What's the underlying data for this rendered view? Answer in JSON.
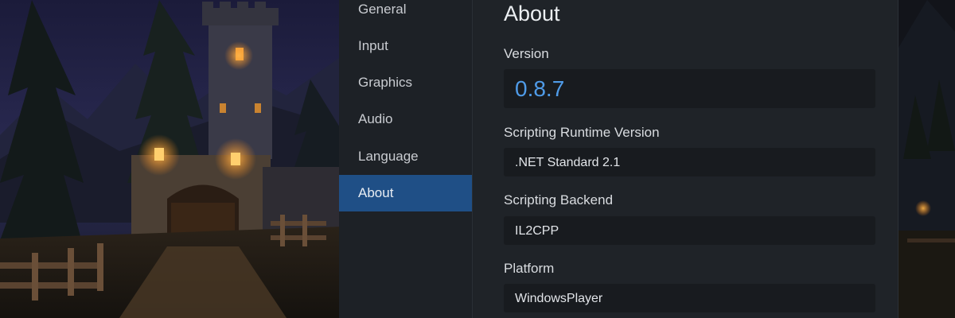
{
  "sidebar": {
    "items": [
      {
        "label": "General"
      },
      {
        "label": "Input"
      },
      {
        "label": "Graphics"
      },
      {
        "label": "Audio"
      },
      {
        "label": "Language"
      },
      {
        "label": "About"
      }
    ],
    "active": "About"
  },
  "about": {
    "title": "About",
    "version_label": "Version",
    "version_value": "0.8.7",
    "runtime_label": "Scripting Runtime Version",
    "runtime_value": ".NET Standard 2.1",
    "backend_label": "Scripting Backend",
    "backend_value": "IL2CPP",
    "platform_label": "Platform",
    "platform_value": "WindowsPlayer"
  },
  "colors": {
    "accent": "#1f4f86",
    "version_text": "#4f9be8",
    "panel": "#1f2328",
    "sidebar": "#1d2126"
  }
}
